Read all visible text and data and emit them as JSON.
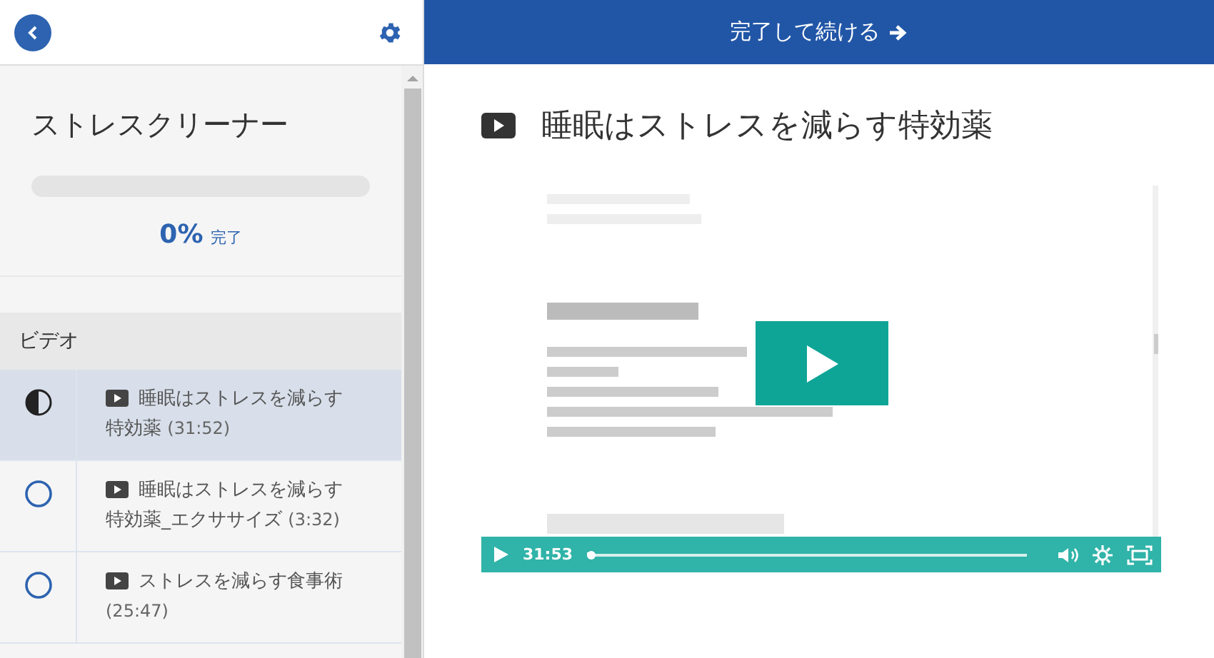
{
  "sidebar": {
    "course_title": "ストレスクリーナー",
    "progress": {
      "level": 0,
      "percent": "0%",
      "label": "完了"
    },
    "section": "ビデオ",
    "lessons": [
      {
        "title": "睡眠はストレスを減らす特効薬",
        "duration": "(31:52)",
        "in_progress": true,
        "selected": true
      },
      {
        "title": "睡眠はストレスを減らす特効薬_エクササイズ",
        "duration": "(3:32)",
        "in_progress": false,
        "selected": false
      },
      {
        "title": "ストレスを減らす食事術",
        "duration": "(25:47)",
        "in_progress": false,
        "selected": false
      }
    ]
  },
  "top_bar": {
    "button": "完了して続ける"
  },
  "lecture": {
    "title": "睡眠はストレスを減らす特効薬",
    "video": {
      "kind": "picture",
      "time": "31:53",
      "level": 0.01
    }
  }
}
